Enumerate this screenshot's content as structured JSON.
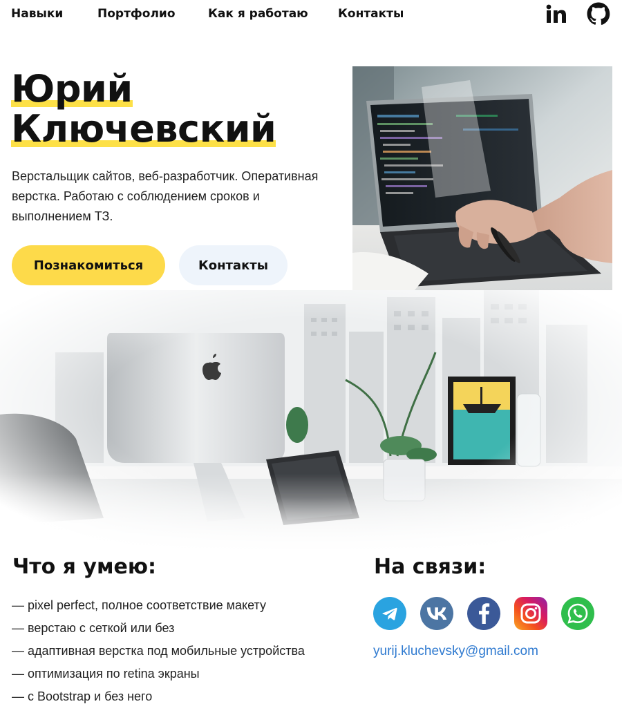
{
  "nav": {
    "items": [
      {
        "label": "Навыки"
      },
      {
        "label": "Портфолио"
      },
      {
        "label": "Как я работаю"
      },
      {
        "label": "Контакты"
      }
    ],
    "social": [
      "linkedin-icon",
      "github-icon"
    ]
  },
  "hero": {
    "name_line1": "Юрий",
    "name_line2": "Ключевский",
    "description": "Верстальщик сайтов, веб-разработчик. Оперативная верстка. Работаю с соблюдением сроков и выполнением ТЗ.",
    "primary_button": "Познакомиться",
    "secondary_button": "Контакты",
    "highlight_color": "#fde047"
  },
  "skills": {
    "title": "Что я умею:",
    "items": [
      "— pixel perfect, полное соответствие макету",
      "— верстаю с сеткой или без",
      "— адаптивная верстка под мобильные устройства",
      "— оптимизация по retina экраны",
      "— с Bootstrap и без него"
    ]
  },
  "contacts": {
    "title": "На связи:",
    "messengers": [
      "telegram-icon",
      "vk-icon",
      "facebook-icon",
      "instagram-icon",
      "whatsapp-icon"
    ],
    "email": "yurij.kluchevsky@gmail.com"
  }
}
